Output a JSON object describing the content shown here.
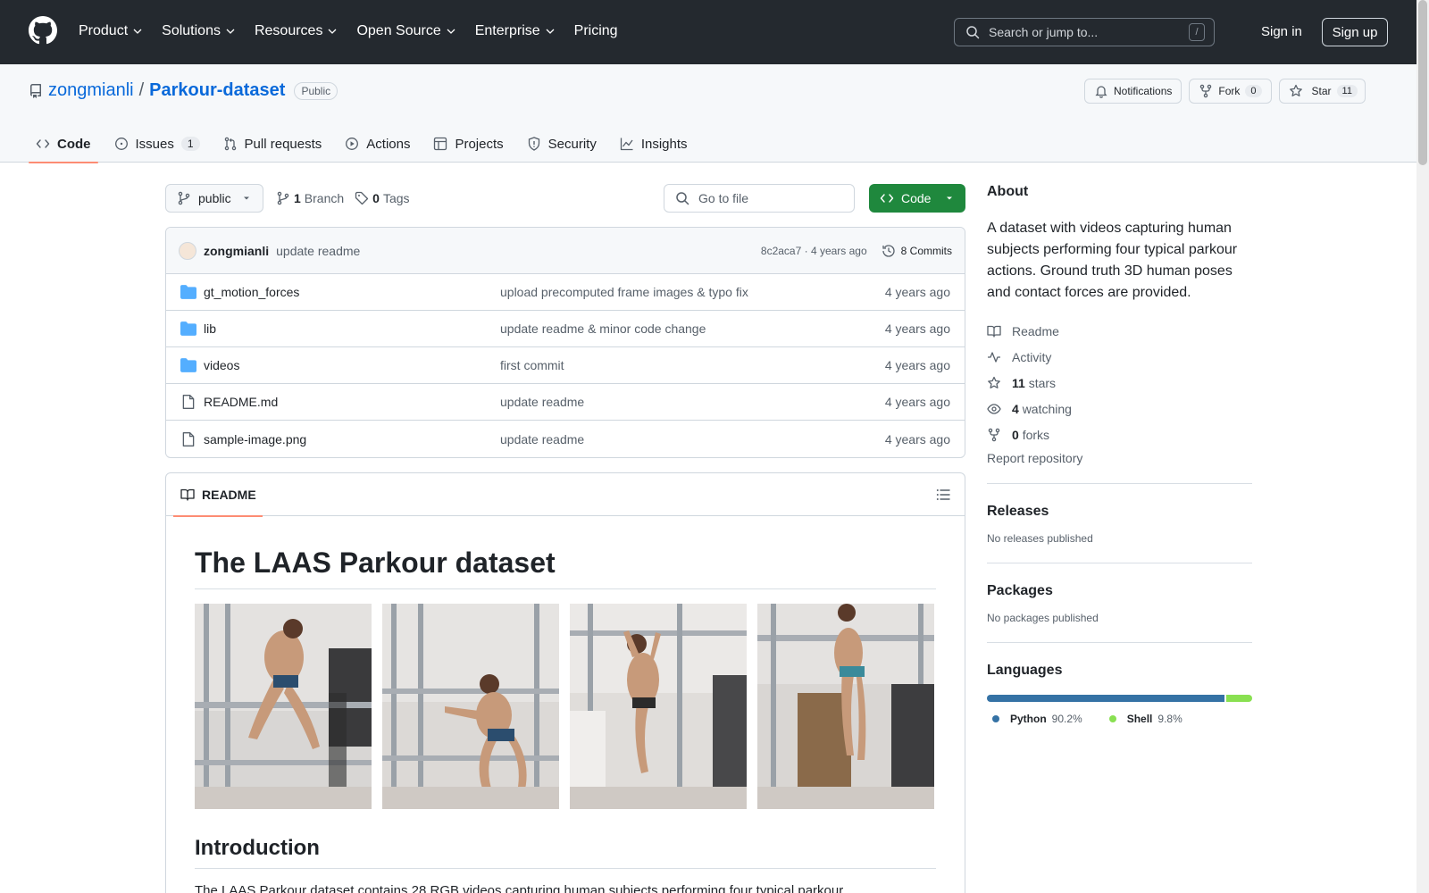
{
  "header": {
    "nav": [
      "Product",
      "Solutions",
      "Resources",
      "Open Source",
      "Enterprise",
      "Pricing"
    ],
    "nav_has_chevron": [
      true,
      true,
      true,
      true,
      true,
      false
    ],
    "search_placeholder": "Search or jump to...",
    "search_shortcut": "/",
    "sign_in": "Sign in",
    "sign_up": "Sign up"
  },
  "repo": {
    "owner": "zongmianli",
    "separator": "/",
    "name": "Parkour-dataset",
    "visibility": "Public",
    "notifications": "Notifications",
    "fork_label": "Fork",
    "fork_count": "0",
    "star_label": "Star",
    "star_count": "11"
  },
  "repo_nav": {
    "code": "Code",
    "issues": "Issues",
    "issues_count": "1",
    "pull_requests": "Pull requests",
    "actions": "Actions",
    "projects": "Projects",
    "security": "Security",
    "insights": "Insights"
  },
  "toolbar": {
    "branch": "public",
    "branch_count": "1",
    "branch_label": "Branch",
    "tag_count": "0",
    "tag_label": "Tags",
    "goto_placeholder": "Go to file",
    "code_button": "Code"
  },
  "commit": {
    "author": "zongmianli",
    "message": "update readme",
    "hash": "8c2aca7",
    "time": "4 years ago",
    "hash_time": "8c2aca7 · 4 years ago",
    "commits": "8 Commits"
  },
  "files": [
    {
      "name": "gt_motion_forces",
      "type": "folder",
      "message": "upload precomputed frame images & typo fix",
      "time": "4 years ago"
    },
    {
      "name": "lib",
      "type": "folder",
      "message": "update readme & minor code change",
      "time": "4 years ago"
    },
    {
      "name": "videos",
      "type": "folder",
      "message": "first commit",
      "time": "4 years ago"
    },
    {
      "name": "README.md",
      "type": "file",
      "message": "update readme",
      "time": "4 years ago"
    },
    {
      "name": "sample-image.png",
      "type": "file",
      "message": "update readme",
      "time": "4 years ago"
    }
  ],
  "readme": {
    "tab": "README",
    "title": "The LAAS Parkour dataset",
    "intro_heading": "Introduction",
    "intro_text": "The LAAS Parkour dataset contains 28 RGB videos capturing human subjects performing four typical parkour"
  },
  "about": {
    "heading": "About",
    "description": "A dataset with videos capturing human subjects performing four typical parkour actions. Ground truth 3D human poses and contact forces are provided.",
    "readme": "Readme",
    "activity": "Activity",
    "stars_count": "11",
    "stars_label": "stars",
    "watching_count": "4",
    "watching_label": "watching",
    "forks_count": "0",
    "forks_label": "forks",
    "report": "Report repository"
  },
  "releases": {
    "heading": "Releases",
    "text": "No releases published"
  },
  "packages": {
    "heading": "Packages",
    "text": "No packages published"
  },
  "languages": {
    "heading": "Languages",
    "items": [
      {
        "name": "Python",
        "percent": "90.2%",
        "value": 90.2,
        "color": "#3572A5"
      },
      {
        "name": "Shell",
        "percent": "9.8%",
        "value": 9.8,
        "color": "#89e051"
      }
    ]
  }
}
